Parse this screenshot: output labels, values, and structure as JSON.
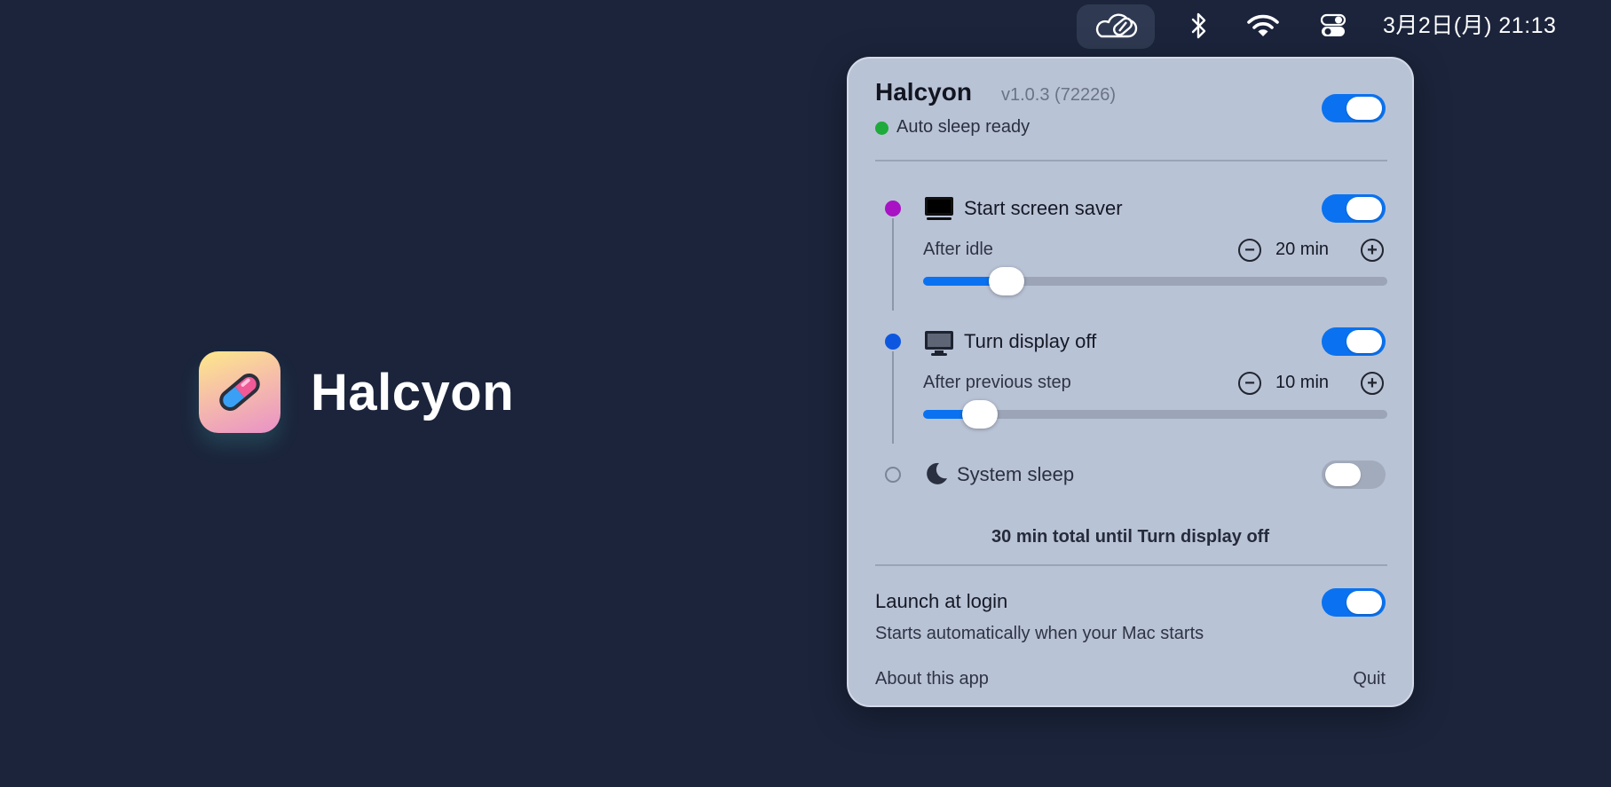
{
  "menubar": {
    "app_icon": "pill-cloud-icon",
    "icons": [
      "bluetooth-icon",
      "wifi-icon",
      "control-center-icon"
    ],
    "clock": "3月2日(月)  21:13"
  },
  "brand": {
    "name": "Halcyon",
    "icon": "pill-app-icon"
  },
  "panel": {
    "title": "Halcyon",
    "version": "v1.0.3 (72226)",
    "enabled": true,
    "status": {
      "text": "Auto sleep ready",
      "color": "#1faa3c"
    },
    "steps": [
      {
        "label": "Start screen saver",
        "icon": "screen-saver-icon",
        "dot_color": "#a811c4",
        "enabled": true,
        "sub_label": "After idle",
        "value": "20 min",
        "slider_fraction": 0.18
      },
      {
        "label": "Turn display off",
        "icon": "display-icon",
        "dot_color": "#0d57e0",
        "enabled": true,
        "sub_label": "After previous step",
        "value": "10 min",
        "slider_fraction": 0.1
      },
      {
        "label": "System sleep",
        "icon": "moon-icon",
        "enabled": false
      }
    ],
    "total": "30 min total until Turn display off",
    "launch": {
      "title": "Launch at login",
      "subtitle": "Starts automatically when your Mac starts",
      "enabled": true
    },
    "about_label": "About this app",
    "quit_label": "Quit"
  },
  "colors": {
    "accent": "#0a72f0",
    "background": "#1b243b",
    "panel": "#b9c3d6"
  }
}
